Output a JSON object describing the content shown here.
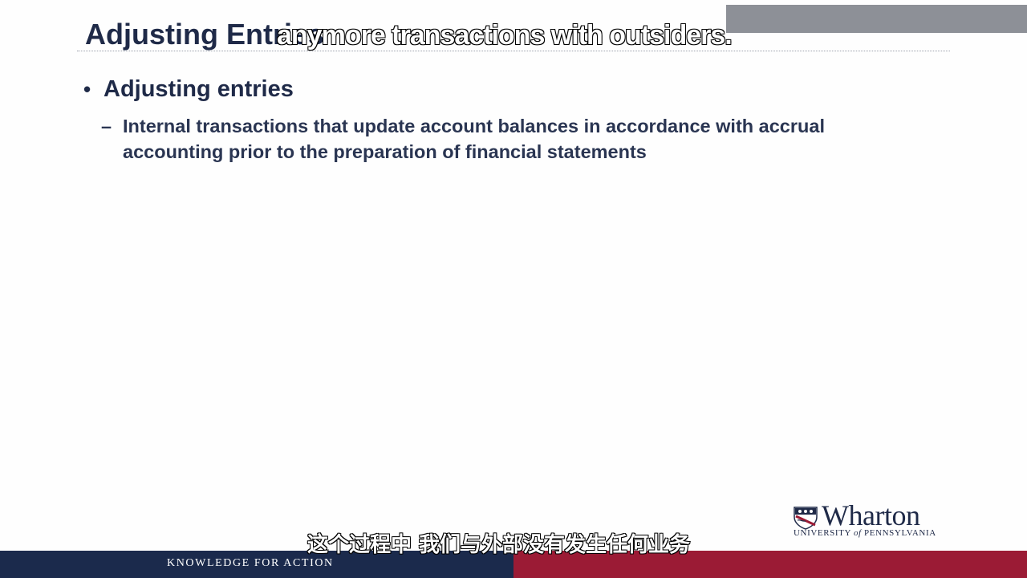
{
  "slide": {
    "title": "Adjusting Entries",
    "bullets": [
      {
        "text": "Adjusting entries",
        "sub": [
          "Internal transactions that update account balances in accordance with accrual accounting prior to the preparation of financial statements"
        ]
      }
    ]
  },
  "branding": {
    "logo_name": "Wharton",
    "logo_sub_a": "UNIVERSITY ",
    "logo_sub_of": "of",
    "logo_sub_b": " PENNSYLVANIA",
    "tagline": "KNOWLEDGE FOR ACTION"
  },
  "subtitles": {
    "top_english": "anymore transactions with outsiders.",
    "bottom_chinese": "这个过程中 我们与外部没有发生任何业务"
  },
  "icons": {
    "logo": "penn-shield-icon"
  },
  "colors": {
    "navy": "#1b2a4c",
    "crimson": "#9b1b35",
    "title_text": "#1f2a48"
  }
}
